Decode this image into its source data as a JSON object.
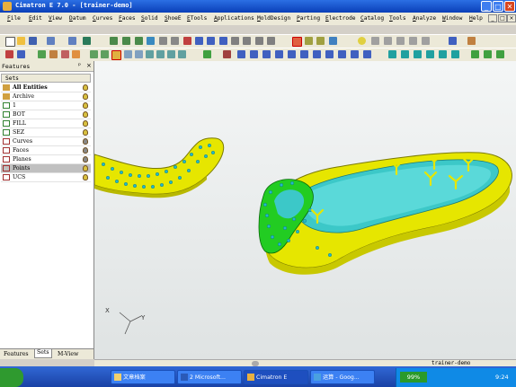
{
  "window": {
    "title": "Cimatron E 7.0 - [trainer-demo]",
    "buttons": [
      "_",
      "□",
      "✕"
    ]
  },
  "menu": [
    "File",
    "Edit",
    "View",
    "Datum",
    "Curves",
    "Faces",
    "Solid",
    "ShoeE",
    "ETools",
    "Applications",
    "MoldDesign",
    "Parting",
    "Electrode",
    "Catalog",
    "Tools",
    "Analyze",
    "Window",
    "Help"
  ],
  "panel": {
    "title": "Features",
    "sets_header": "Sets",
    "items": [
      {
        "label": "All Entities",
        "bold": true
      },
      {
        "label": "Archive"
      },
      {
        "label": "1"
      },
      {
        "label": "BOT"
      },
      {
        "label": "FILL"
      },
      {
        "label": "SEZ"
      },
      {
        "label": "Curves"
      },
      {
        "label": "Faces"
      },
      {
        "label": "Planes"
      },
      {
        "label": "Points",
        "selected": true
      },
      {
        "label": "UCS"
      }
    ],
    "tabs": [
      "Features",
      "Sets",
      "M-View"
    ],
    "active_tab": "Sets"
  },
  "viewport": {
    "status": "trainer-demo",
    "axis_labels": {
      "x": "X",
      "y": "Y"
    }
  },
  "taskbar": {
    "buttons": [
      {
        "label": "文章档案"
      },
      {
        "label": "2 Microsoft..."
      },
      {
        "label": "Cimatron E"
      },
      {
        "label": "运算 - Goog..."
      }
    ],
    "tray_percent": "99%",
    "clock": "9:24"
  },
  "colors": {
    "accent": "#0a3fb8",
    "model_yellow": "#e6e600",
    "model_cyan": "#3cc8c8",
    "model_green": "#22cc22",
    "points": "#23b9c9"
  }
}
